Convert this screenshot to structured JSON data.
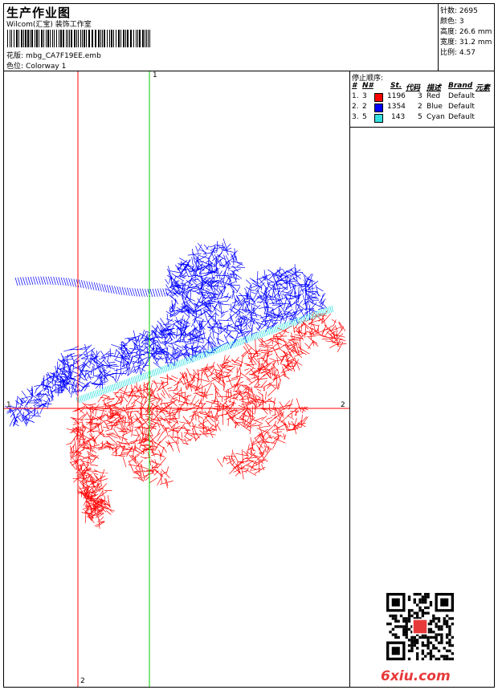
{
  "header": {
    "title": "生产作业图",
    "company": "Wilcom(汇宝) 装饰工作室",
    "design_label": "花版:",
    "design_file": "mbg_CA7F19EE.emb",
    "colorway_label": "色位:",
    "colorway": "Colorway 1"
  },
  "stats": [
    {
      "label": "针数:",
      "value": "2695"
    },
    {
      "label": "颜色:",
      "value": "3"
    },
    {
      "label": "高度:",
      "value": "26.6 mm"
    },
    {
      "label": "宽度:",
      "value": "31.2 mm"
    },
    {
      "label": "比例:",
      "value": "4.57"
    }
  ],
  "axes": {
    "x_left": "1",
    "x_right": "2",
    "y_top": "1",
    "y_bottom": "2"
  },
  "stop_sequence": {
    "title": "停止顺序:",
    "columns": [
      "#",
      "N#",
      "St.",
      "代码",
      "描述",
      "Brand",
      "元素"
    ],
    "rows": [
      {
        "idx": "1.",
        "n": "3",
        "color": "#ff0000",
        "st": "1196",
        "code": "3",
        "desc": "Red",
        "brand": "Default"
      },
      {
        "idx": "2.",
        "n": "2",
        "color": "#0000ff",
        "st": "1354",
        "code": "2",
        "desc": "Blue",
        "brand": "Default"
      },
      {
        "idx": "3.",
        "n": "5",
        "color": "#33e0e0",
        "st": "143",
        "code": "5",
        "desc": "Cyan",
        "brand": "Default"
      }
    ]
  },
  "colors": {
    "red": "#ff0000",
    "blue": "#0000ff",
    "cyan": "#33e0e0",
    "axis_red": "#ff0000",
    "axis_green": "#00cc00"
  }
}
